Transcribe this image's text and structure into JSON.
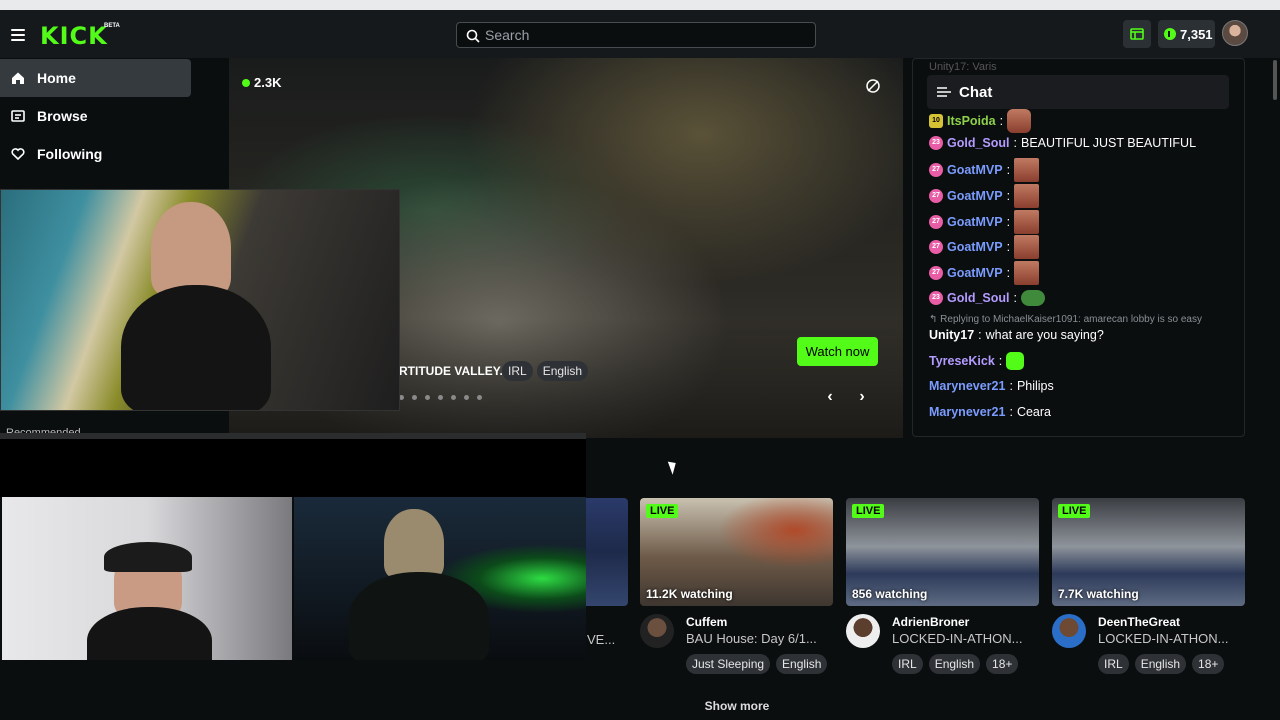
{
  "header": {
    "logo": "KICK",
    "logo_badge": "BETA",
    "search_placeholder": "Search",
    "coins": "7,351"
  },
  "sidebar": {
    "items": [
      {
        "label": "Home",
        "icon": "home-icon",
        "active": true
      },
      {
        "label": "Browse",
        "icon": "browse-icon"
      },
      {
        "label": "Following",
        "icon": "heart-icon"
      }
    ],
    "partial_label": "Recommended"
  },
  "hero": {
    "viewers": "2.3K",
    "title": "RTITUDE VALLEY.",
    "tags": [
      "IRL",
      "English"
    ],
    "watch_now": "Watch now",
    "prev_arrow": "‹",
    "next_arrow": "›"
  },
  "chat": {
    "title": "Chat",
    "faded_top": "Unity17: Varis",
    "messages": [
      {
        "badge": "10",
        "user": "ItsPoida",
        "text": ""
      },
      {
        "badge": "23",
        "user": "Gold_Soul",
        "text": "BEAUTIFUL JUST BEAUTIFUL"
      },
      {
        "badge": "27",
        "user": "GoatMVP",
        "text": ""
      },
      {
        "badge": "27",
        "user": "GoatMVP",
        "text": ""
      },
      {
        "badge": "27",
        "user": "GoatMVP",
        "text": ""
      },
      {
        "badge": "27",
        "user": "GoatMVP",
        "text": ""
      },
      {
        "badge": "27",
        "user": "GoatMVP",
        "text": ""
      },
      {
        "badge": "23",
        "user": "Gold_Soul",
        "text": ""
      },
      {
        "user": "Unity17",
        "text": "what are you saying?"
      },
      {
        "user": "TyreseKick",
        "text": ""
      },
      {
        "user": "Marynever21",
        "text": "Philips"
      },
      {
        "user": "Marynever21",
        "text": "Ceara"
      }
    ],
    "reply_text": "Replying to MichaelKaiser1091: amarecan lobby is so easy"
  },
  "cards": [
    {
      "live": "LIVE",
      "watching": "11.2K watching",
      "name": "Cuffem",
      "title": "BAU House: Day 6/1...",
      "tags": [
        "Just Sleeping",
        "English"
      ]
    },
    {
      "live": "LIVE",
      "watching": "856 watching",
      "name": "AdrienBroner",
      "title": "LOCKED-IN-ATHON...",
      "tags": [
        "IRL",
        "English",
        "18+"
      ]
    },
    {
      "live": "LIVE",
      "watching": "7.7K watching",
      "name": "DeenTheGreat",
      "title": "LOCKED-IN-ATHON...",
      "tags": [
        "IRL",
        "English",
        "18+"
      ]
    }
  ],
  "partial_card_title": "VE...",
  "show_more": "Show more",
  "colors": {
    "accent": "#53fc18",
    "bg": "#0b0e0f",
    "panel": "#16191c"
  }
}
